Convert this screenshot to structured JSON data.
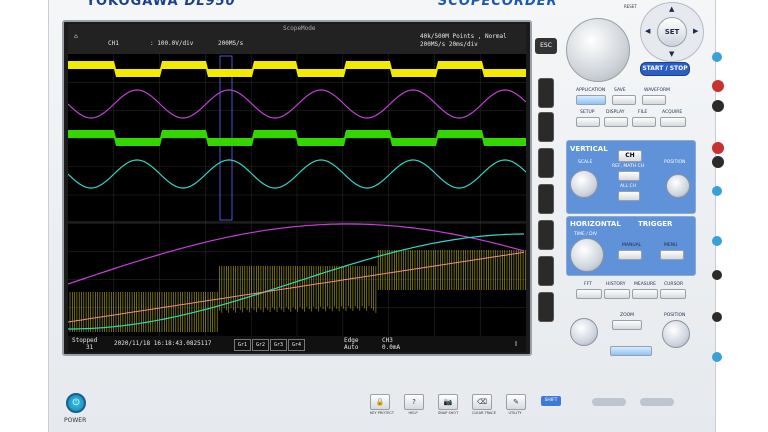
{
  "brand": {
    "name": "YOKOGAWA",
    "model": "DL950",
    "series": "SCOPECORDER"
  },
  "screen": {
    "title": "ScopeMode",
    "channel": "CH1",
    "vdiv": ": 100.0V/div",
    "rate": "200MS/s",
    "record_info_1": "40k/500M Points , Normal",
    "record_info_2": "200MS/s   20ms/div",
    "status": "Stopped",
    "count": "31",
    "timestamp": "2020/11/18 16:18:43.0825117",
    "groups": [
      "Gr1",
      "Gr2",
      "Gr3",
      "Gr4"
    ],
    "trigger_type": "Edge",
    "trigger_mode": "Auto",
    "trigger_source": "CH3",
    "trigger_level": "0.0mA"
  },
  "esc_label": "ESC",
  "controls": {
    "reset": "RESET",
    "set": "SET",
    "start_stop": "START / STOP",
    "application": "APPLICATION",
    "save": "SAVE",
    "waveform": "WAVEFORM",
    "setup": "SETUP",
    "display": "DISPLAY",
    "file": "FILE",
    "acquire": "ACQUIRE",
    "vertical": "VERTICAL",
    "ch": "CH",
    "math": "REF, MATH CH",
    "allch": "ALL CH",
    "horizontal": "HORIZONTAL",
    "trigger": "TRIGGER",
    "manual": "MANUAL",
    "menu": "MENU",
    "fft": "FFT",
    "history": "HISTORY",
    "measure": "MEASURE",
    "cursor": "CURSOR",
    "zoom": "ZOOM",
    "position": "POSITION",
    "mode": "MODE",
    "scale": "SCALE",
    "timediv": "TIME / DIV"
  },
  "bottom": {
    "power": "POWER",
    "keys": [
      {
        "glyph": "🔒",
        "label": "KEY PROTECT"
      },
      {
        "glyph": "?",
        "label": "HELP"
      },
      {
        "glyph": "📷",
        "label": "SNAP SHOT"
      },
      {
        "glyph": "⌫",
        "label": "CLEAR TRACE"
      },
      {
        "glyph": "✎",
        "label": "UTILITY"
      }
    ],
    "shift": "SHIFT"
  },
  "colors": {
    "ch1": "#f2ea00",
    "ch2": "#c33fd6",
    "ch3": "#34d600",
    "ch4": "#32d6c6",
    "accent": "#2c5fc4"
  }
}
